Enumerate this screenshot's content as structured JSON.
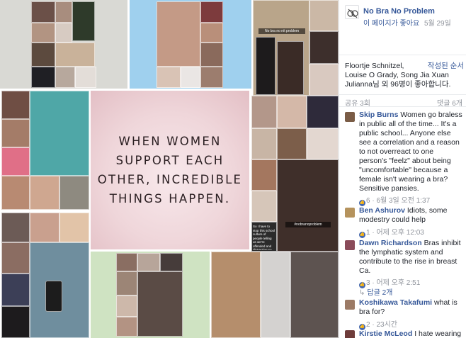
{
  "post": {
    "image_quote": {
      "line1": "WHEN WOMEN",
      "line2": "SUPPORT EACH",
      "line3": "OTHER, INCREDIBLE",
      "line4": "THINGS HAPPEN."
    },
    "snap_caption_top": "No bra no nit problem",
    "snap_caption_right": "#nobranoproblem",
    "snap_small_text": "So I have to stop this school culture of people telling us we're offended and distracting so its gone"
  },
  "page": {
    "name": "No Bra No Problem",
    "like_prompt": "이 페이지가 좋아요",
    "date": "5월 29일"
  },
  "reactions": {
    "names_line1": "Floortje Schnitzel,",
    "names_line2": "Louise O Grady, Song Jia Xuan",
    "names_line3": "Julianna님 외 96명이 좋아합니다.",
    "sort_order": "작성된 순서"
  },
  "counts": {
    "shares": "공유 3회",
    "comments": "댓글 6개"
  },
  "comments": [
    {
      "author": "Skip Burns",
      "text": "Women go braless in public all of the time... It's a public school... Anyone else see a correlation and a reason to not overreact to one person's \"feelz\" about being \"uncomfortable\" because a female isn't wearing a bra? Sensitive pansies.",
      "likes": "6",
      "time": "6월 3일 오전 1:37"
    },
    {
      "author": "Ben Ashurov",
      "text": "Idiots, some modestry could help",
      "likes": "1",
      "time": "어제 오후 12:03"
    },
    {
      "author": "Dawn Richardson",
      "text": "Bras inhibit the lymphatic system and contribute to the rise in breast Ca.",
      "likes": "3",
      "time": "어제 오후 2:51",
      "replies": "답글 2개"
    },
    {
      "author": "Koshikawa Takafumi",
      "text": "what is bra for?",
      "likes": "2",
      "time": "23시간"
    },
    {
      "author": "Kirstie McLeod",
      "text": "I hate wearing"
    }
  ],
  "colors": {
    "link": "#365899",
    "meta": "#90949c",
    "like_blue": "#4267b2",
    "card_pink": "#efd6da"
  }
}
